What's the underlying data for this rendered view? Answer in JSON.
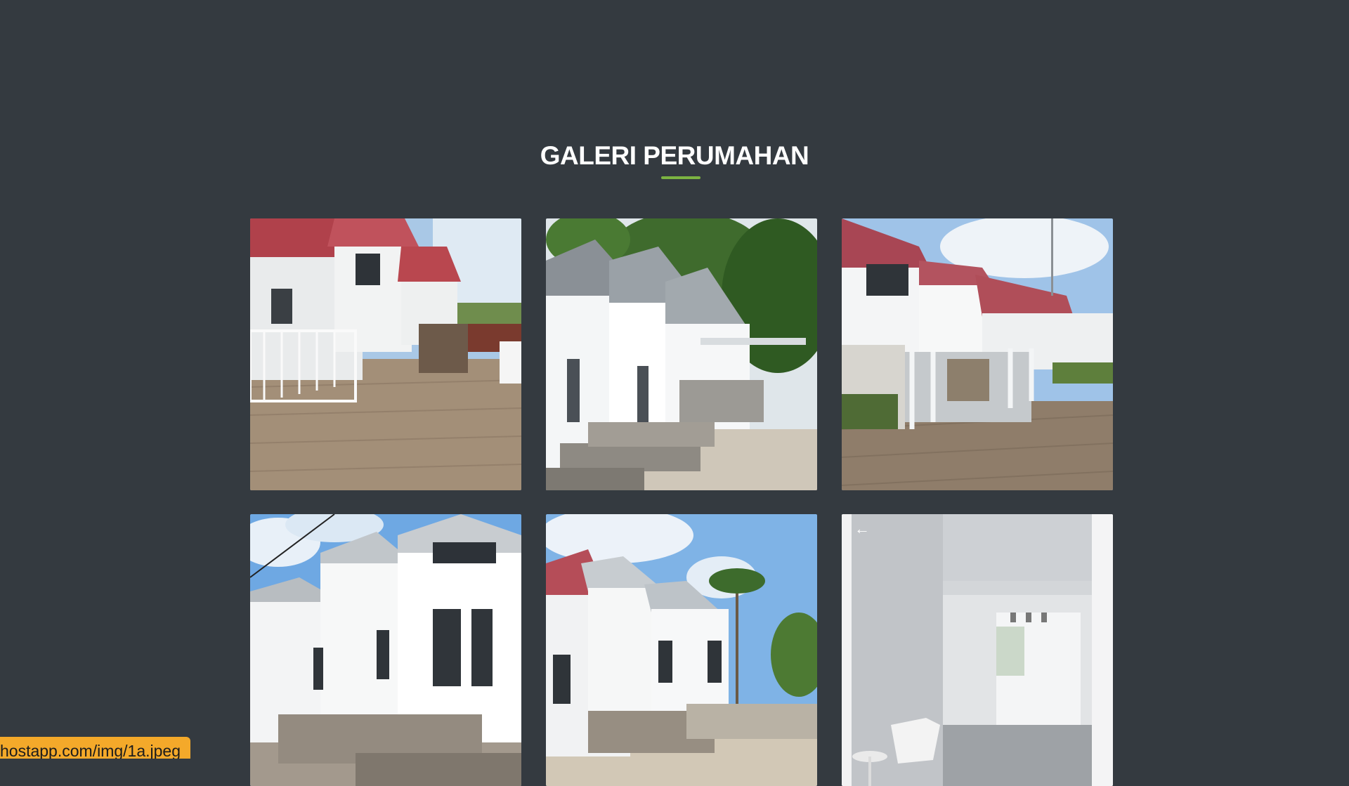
{
  "gallery": {
    "title": "GALERI PERUMAHAN",
    "accent_color": "#7cb342",
    "background_color": "#343a40",
    "images": [
      {
        "label": "house-photo-1"
      },
      {
        "label": "house-photo-2"
      },
      {
        "label": "house-photo-3"
      },
      {
        "label": "house-photo-4"
      },
      {
        "label": "house-photo-5"
      },
      {
        "label": "house-photo-6"
      }
    ],
    "back_arrow": "←"
  },
  "status_bar": {
    "url_text": "hostapp.com/img/1a.jpeg"
  }
}
